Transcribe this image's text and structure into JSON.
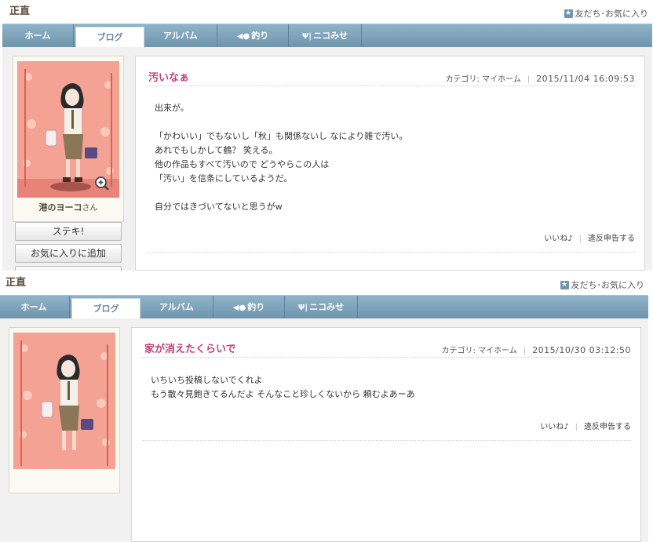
{
  "user": {
    "name": "正直"
  },
  "fav_link": {
    "label": "友だち･お気に入り"
  },
  "nav": {
    "tabs": [
      {
        "label": "ホーム"
      },
      {
        "label": "ブログ"
      },
      {
        "label": "アルバム"
      },
      {
        "label": "釣り"
      },
      {
        "label": "ニコみせ"
      }
    ]
  },
  "profile": {
    "name": "港のヨーコ",
    "suffix": "さん",
    "buttons": {
      "suteki": "ステキ!",
      "add_favorite": "お気に入りに追加"
    }
  },
  "posts": [
    {
      "title": "汚いなぁ",
      "category": "カテゴリ: マイホーム",
      "date": "2015/11/04 16:09:53",
      "body": [
        "出来が。",
        "",
        "「かわいい」でもないし「秋」も関係ないし なにより雑で汚い。",
        "あれでもしかして鶴？ 笑える。",
        "他の作品もすべて汚いので どうやらこの人は",
        "「汚い」を信条にしているようだ。",
        "",
        "自分ではきづいてないと思うがw"
      ],
      "like": "いいね♪",
      "report": "違反申告する"
    },
    {
      "title": "家が消えたくらいで",
      "category": "カテゴリ: マイホーム",
      "date": "2015/10/30 03:12:50",
      "body": [
        "いちいち投稿しないでくれよ",
        "もう散々見飽きてるんだよ そんなこと珍しくないから 頼むよあーあ"
      ],
      "like": "いいね♪",
      "report": "違反申告する"
    }
  ]
}
